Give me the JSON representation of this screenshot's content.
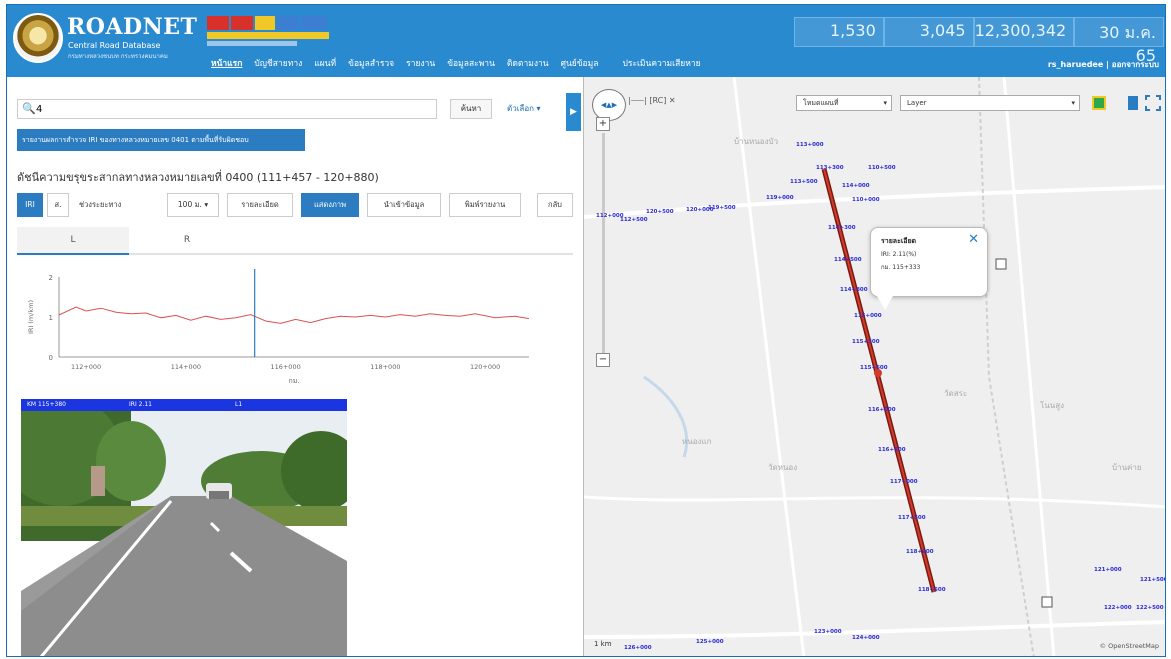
{
  "header": {
    "brand_title": "ROADNET",
    "brand_subtitle": "Central Road Database",
    "brand_subtitle2": "กรมทางหลวงชนบท กระทรวงคมนาคม",
    "nav": [
      "หน้าแรก",
      "บัญชีสายทาง",
      "แผนที่",
      "ข้อมูลสำรวจ",
      "รายงาน",
      "ข้อมูลสะพาน",
      "ติดตามงาน",
      "ศูนย์ข้อมูล",
      "ประเมินความเสียหาย"
    ],
    "stats": [
      "1,530",
      "3,045",
      "12,300,342",
      "30 ม.ค. 65"
    ],
    "user_links": "rs_haruedee | ออกจากระบบ",
    "colors": {
      "header_bg": "#2a8ad0",
      "primary": "#2b7cc0",
      "road_line": "#b3221e"
    }
  },
  "left": {
    "search_placeholder": "ค้นหา",
    "search_value": "4",
    "search_button": "ค้นหา",
    "more_dropdown": "ตัวเลือก ▾",
    "breadcrumb": "รายงานผลการสำรวจ IRI ของทางหลวงหมายเลข 0401 ตามพื้นที่รับผิดชอบ",
    "section_title": "ดัชนีความขรุขระสากลทางหลวงหมายเลขที่ 0400 (111+457 - 120+880)",
    "toolbar": {
      "btn_a": "IRI",
      "btn_b": "ส.",
      "interval_label": "ช่วงระยะทาง",
      "interval_value": "100 ม. ▾",
      "btn_report": "รายละเอียด",
      "btn_map": "แสดงภาพ",
      "btn_export": "นำเข้าข้อมูล",
      "btn_print": "พิมพ์รายงาน",
      "btn_back": "กลับ"
    },
    "subtabs": [
      "L",
      "R"
    ],
    "photo_bar": [
      "KM 115+380",
      "IRI 2.11",
      "L1"
    ]
  },
  "chart_data": {
    "type": "line",
    "title": "",
    "xlabel": "กม.",
    "ylabel": "IRI (m/km)",
    "ylim": [
      0,
      2
    ],
    "xlim": [
      111457,
      120880
    ],
    "x_ticks": [
      112000,
      114000,
      116000,
      118000,
      120000
    ],
    "x_tick_labels": [
      "112+000",
      "114+000",
      "116+000",
      "118+000",
      "120+000"
    ],
    "y_ticks": [
      0,
      1,
      2
    ],
    "marker_x": 115380,
    "series": [
      {
        "values": [
          [
            111457,
            1.05
          ],
          [
            111800,
            1.25
          ],
          [
            112000,
            1.15
          ],
          [
            112300,
            1.22
          ],
          [
            112600,
            1.12
          ],
          [
            112900,
            1.08
          ],
          [
            113200,
            1.1
          ],
          [
            113500,
            0.98
          ],
          [
            113800,
            1.04
          ],
          [
            114100,
            0.92
          ],
          [
            114400,
            1.02
          ],
          [
            114700,
            0.94
          ],
          [
            115000,
            0.98
          ],
          [
            115300,
            1.06
          ],
          [
            115600,
            0.9
          ],
          [
            115900,
            0.84
          ],
          [
            116200,
            0.94
          ],
          [
            116500,
            0.86
          ],
          [
            116800,
            0.96
          ],
          [
            117100,
            1.02
          ],
          [
            117400,
            1.0
          ],
          [
            117700,
            1.04
          ],
          [
            118000,
            1.0
          ],
          [
            118300,
            1.06
          ],
          [
            118600,
            1.02
          ],
          [
            118900,
            1.08
          ],
          [
            119200,
            1.04
          ],
          [
            119500,
            1.02
          ],
          [
            119800,
            1.08
          ],
          [
            120200,
            0.98
          ],
          [
            120600,
            1.02
          ],
          [
            120880,
            0.96
          ]
        ]
      }
    ]
  },
  "map": {
    "select_a": "โหมดแผนที่",
    "select_b": "Layer",
    "measure_label": "|⸺| [RC] ✕",
    "popup": {
      "title": "รายละเอียด",
      "line1": "IRI: 2.11(%)",
      "line2": "กม. 115+333"
    },
    "km_tags": [
      "113+000",
      "113+300",
      "113+500",
      "114+000",
      "114+300",
      "114+500",
      "114+800",
      "115+000",
      "115+300",
      "115+600",
      "116+000",
      "116+500",
      "117+000",
      "117+500",
      "118+000",
      "118+500",
      "119+000",
      "119+500",
      "120+000",
      "120+500",
      "112+000",
      "112+500",
      "110+000",
      "110+500",
      "121+000",
      "121+500",
      "122+000",
      "122+500",
      "123+000",
      "124+000",
      "125+000",
      "126+000"
    ],
    "places": [
      "บ้านหนองบัว",
      "วัดสระ",
      "หนองแก",
      "โนนสูง",
      "วัดหนอง",
      "บ้านค่าย"
    ],
    "scale": "1 km",
    "copyright": "© OpenStreetMap"
  }
}
